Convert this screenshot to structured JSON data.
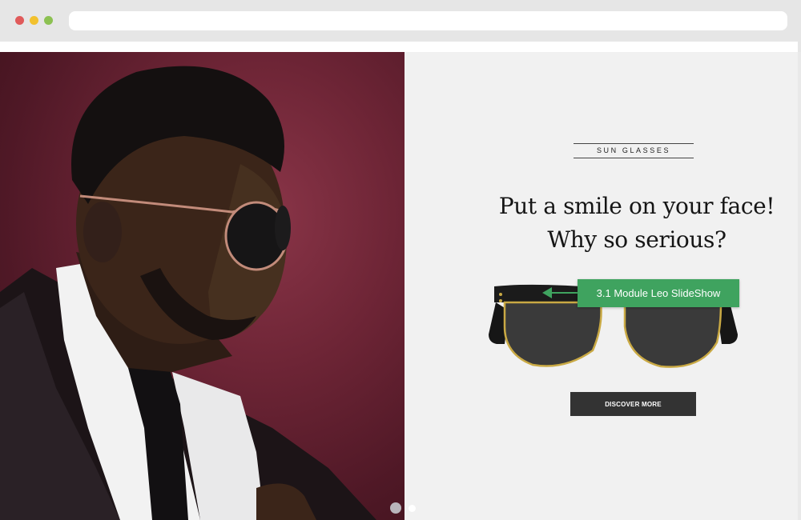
{
  "slide": {
    "category": "SUN GLASSES",
    "headline_line1": "Put a smile on your face!",
    "headline_line2": "Why so serious?",
    "tooltip_label": "3.1 Module Leo SlideShow",
    "button_label": "DISCOVER MORE"
  },
  "pagination": {
    "total": 2,
    "active": 1
  },
  "colors": {
    "tooltip": "#3fa35f",
    "button": "#333333",
    "content_background": "#f1f1f1",
    "photo_background": "#6e2536"
  }
}
